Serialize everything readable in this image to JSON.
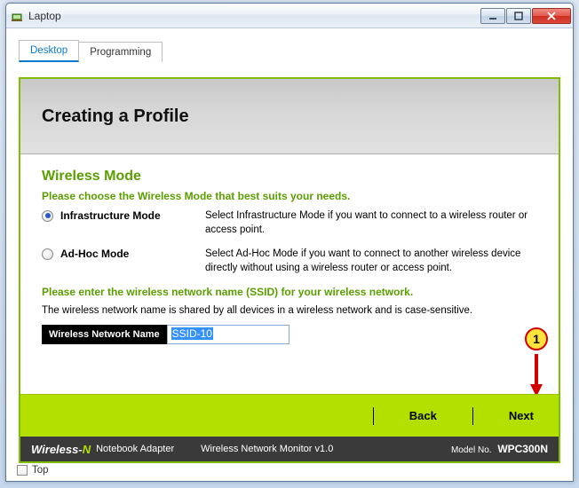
{
  "window": {
    "title": "Laptop"
  },
  "tabs": {
    "desktop": "Desktop",
    "programming": "Programming"
  },
  "header": {
    "title": "Creating a Profile"
  },
  "wireless": {
    "section_title": "Wireless Mode",
    "prompt_mode": "Please choose the Wireless Mode that best suits your needs.",
    "infra_label": "Infrastructure Mode",
    "infra_desc": "Select Infrastructure Mode if you want to connect to a wireless router or access point.",
    "adhoc_label": "Ad-Hoc Mode",
    "adhoc_desc": "Select Ad-Hoc Mode if you want to connect to another wireless device directly without using a wireless router or access point.",
    "prompt_ssid": "Please enter the wireless network name (SSID) for your wireless network.",
    "ssid_note": "The wireless network name is shared by all devices in a wireless network and is case-sensitive.",
    "ssid_label": "Wireless Network Name",
    "ssid_value": "SSID-10"
  },
  "callout": {
    "number": "1"
  },
  "nav": {
    "back": "Back",
    "next": "Next"
  },
  "footer": {
    "brand_pre": "Wireless-",
    "brand_n": "N",
    "adapter": "Notebook Adapter",
    "monitor": "Wireless Network Monitor  v1.0",
    "model_label": "Model No.",
    "model": "WPC300N"
  },
  "bottom": {
    "top_label": "Top"
  }
}
